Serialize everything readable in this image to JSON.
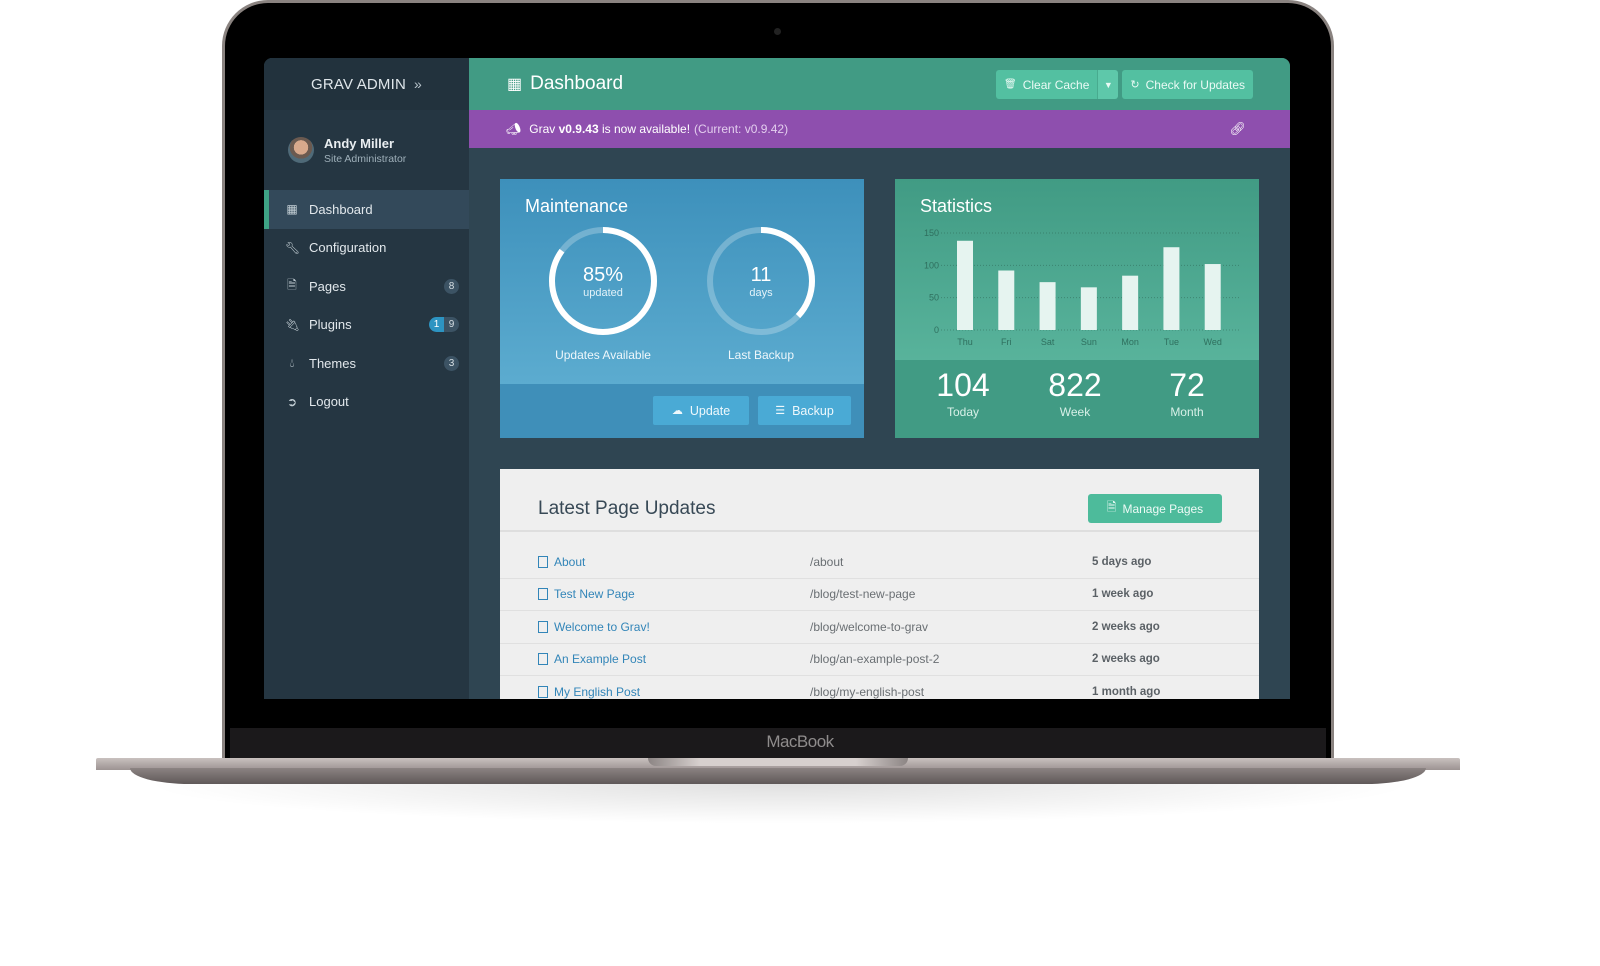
{
  "device": {
    "label": "MacBook"
  },
  "sidebar": {
    "brand": "GRAV ADMIN",
    "brand_icon": "double-chevron-right-icon",
    "user": {
      "name": "Andy Miller",
      "role": "Site Administrator"
    },
    "items": [
      {
        "label": "Dashboard",
        "icon": "grid-icon",
        "active": true
      },
      {
        "label": "Configuration",
        "icon": "wrench-icon"
      },
      {
        "label": "Pages",
        "icon": "file-icon",
        "badge": "8"
      },
      {
        "label": "Plugins",
        "icon": "plug-icon",
        "badge_updates": "1",
        "badge": "9"
      },
      {
        "label": "Themes",
        "icon": "tint-icon",
        "badge": "3"
      },
      {
        "label": "Logout",
        "icon": "sign-out-icon"
      }
    ]
  },
  "header": {
    "title": "Dashboard",
    "clear_cache": "Clear Cache",
    "check_updates": "Check for Updates"
  },
  "notice": {
    "prefix": "Grav",
    "version": "v0.9.43",
    "message": "is now available!",
    "current": "(Current: v0.9.42)"
  },
  "maintenance": {
    "title": "Maintenance",
    "updates": {
      "value": "85%",
      "sub": "updated",
      "label": "Updates Available",
      "fraction": 0.85
    },
    "backup": {
      "value": "11",
      "sub": "days",
      "label": "Last Backup",
      "fraction": 0.37
    },
    "update_button": "Update",
    "backup_button": "Backup"
  },
  "statistics": {
    "title": "Statistics",
    "today": {
      "value": "104",
      "label": "Today"
    },
    "week": {
      "value": "822",
      "label": "Week"
    },
    "month": {
      "value": "72",
      "label": "Month"
    }
  },
  "chart_data": {
    "type": "bar",
    "title": "Statistics",
    "categories": [
      "Thu",
      "Fri",
      "Sat",
      "Sun",
      "Mon",
      "Tue",
      "Wed"
    ],
    "values": [
      138,
      92,
      74,
      66,
      84,
      128,
      102
    ],
    "yticks": [
      0,
      50,
      100,
      150
    ],
    "ylim": [
      0,
      150
    ],
    "xlabel": "",
    "ylabel": "",
    "grid": true
  },
  "pages": {
    "title": "Latest Page Updates",
    "manage_button": "Manage Pages",
    "rows": [
      {
        "title": "About",
        "route": "/about",
        "time": "5 days ago"
      },
      {
        "title": "Test New Page",
        "route": "/blog/test-new-page",
        "time": "1 week ago"
      },
      {
        "title": "Welcome to Grav!",
        "route": "/blog/welcome-to-grav",
        "time": "2 weeks ago"
      },
      {
        "title": "An Example Post",
        "route": "/blog/an-example-post-2",
        "time": "2 weeks ago"
      },
      {
        "title": "My English Post",
        "route": "/blog/my-english-post",
        "time": "1 month ago"
      }
    ]
  }
}
